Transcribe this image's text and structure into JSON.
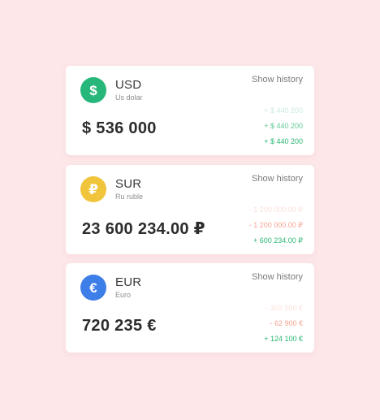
{
  "cards": [
    {
      "code": "USD",
      "name": "Us dolar",
      "icon": "dollar-icon",
      "icon_glyph": "$",
      "icon_color": "#27b77a",
      "amount": "$ 536 000",
      "history_label": "Show history",
      "changes": [
        {
          "text": "+ $ 440 200",
          "kind": "pos",
          "opacity": "faded"
        },
        {
          "text": "+ $ 440 200",
          "kind": "pos",
          "opacity": "mid"
        },
        {
          "text": "+ $ 440 200",
          "kind": "pos",
          "opacity": "full"
        }
      ]
    },
    {
      "code": "SUR",
      "name": "Ru ruble",
      "icon": "ruble-icon",
      "icon_glyph": "₽",
      "icon_color": "#f1c53b",
      "amount": "23 600 234.00 ₽",
      "history_label": "Show history",
      "changes": [
        {
          "text": "- 1 200 000.00 ₽",
          "kind": "neg",
          "opacity": "faded"
        },
        {
          "text": "- 1 200 000.00 ₽",
          "kind": "neg",
          "opacity": "mid"
        },
        {
          "text": "+ 600 234.00 ₽",
          "kind": "pos",
          "opacity": "full"
        }
      ]
    },
    {
      "code": "EUR",
      "name": "Euro",
      "icon": "euro-icon",
      "icon_glyph": "€",
      "icon_color": "#3d7ee8",
      "amount": "720 235 €",
      "history_label": "Show history",
      "changes": [
        {
          "text": "- 302 000 €",
          "kind": "neg",
          "opacity": "faded"
        },
        {
          "text": "- 62 900 €",
          "kind": "neg",
          "opacity": "mid"
        },
        {
          "text": "+ 124 100 €",
          "kind": "pos",
          "opacity": "full"
        }
      ]
    }
  ]
}
